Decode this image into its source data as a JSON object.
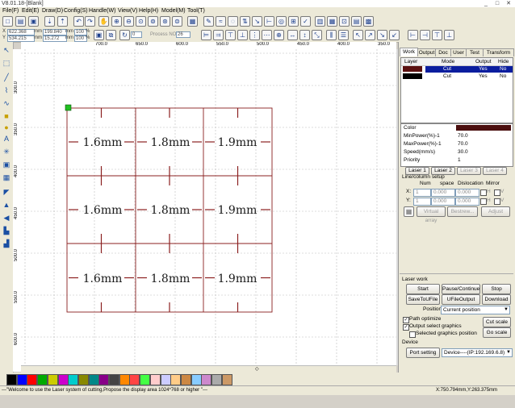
{
  "window": {
    "title": "V8.01.18-[Blank]",
    "controls": [
      "_",
      "□",
      "✕"
    ]
  },
  "menus": [
    "File(F)",
    "Edit(E)",
    "Draw(D)",
    "Config(S)",
    "Handle(W)",
    "View(V)",
    "Help(H)",
    "Model(M)",
    "Tool(T)"
  ],
  "toolbar2": {
    "x_label": "X",
    "x_value": "622.368",
    "x_unit": "mm",
    "y_label": "Y",
    "y_value": "534.215",
    "y_unit": "mm",
    "w_value": "199.840",
    "h_value": "15.272",
    "w_unit": "mm",
    "h_unit": "mm",
    "pct_w": "100",
    "pct_h": "100",
    "pct_unit": "%",
    "process_value": "0",
    "process_label": "Process NO",
    "process_no": "26"
  },
  "ruler": {
    "top": [
      "750.0",
      "700.0",
      "650.0",
      "600.0",
      "550.0",
      "500.0",
      "450.0",
      "400.0",
      "350.0"
    ],
    "left": [
      "300.0",
      "350.0",
      "400.0",
      "450.0",
      "500.0",
      "550.0",
      "600.0"
    ]
  },
  "canvas": {
    "labels": [
      "1.6mm",
      "1.8mm",
      "1.9mm",
      "1.6mm",
      "1.8mm",
      "1.9mm",
      "1.6mm",
      "1.8mm",
      "1.9mm"
    ],
    "line_color": "#8b2020",
    "handle_color": "#20c020"
  },
  "panel": {
    "tabs": [
      "Work",
      "Output",
      "Doc",
      "User",
      "Test",
      "Transform"
    ],
    "layer_headers": [
      "Layer",
      "Mode",
      "Output",
      "Hide"
    ],
    "layers": [
      {
        "color": "#5a1010",
        "mode": "Cut",
        "output": "Yes",
        "hide": "No",
        "selected": true
      },
      {
        "color": "#000000",
        "mode": "Cut",
        "output": "Yes",
        "hide": "No",
        "selected": false
      }
    ],
    "props": [
      {
        "label": "Color",
        "value": ""
      },
      {
        "label": "MinPower(%)-1",
        "value": "70.0"
      },
      {
        "label": "MaxPower(%)-1",
        "value": "70.0"
      },
      {
        "label": "Speed(mm/s)",
        "value": "30.0"
      },
      {
        "label": "Priority",
        "value": "1"
      }
    ],
    "prop_color": "#4a0e0e",
    "layer_buttons": [
      "Laser 1",
      "Laser 2",
      "Laser 3",
      "Laser 4"
    ],
    "array_title": "Line/column setup",
    "array_headers": [
      "Num",
      "space",
      "Dislocation",
      "Mirror"
    ],
    "array_rows": [
      {
        "axis": "X:",
        "num": "1",
        "space": "0.000",
        "disloc": "0.000",
        "m1": "H",
        "m2": "V"
      },
      {
        "axis": "Y:",
        "num": "1",
        "space": "0.000",
        "disloc": "0.000",
        "m1": "H",
        "m2": "V"
      }
    ],
    "array_buttons": [
      "Virtual array",
      "Bestrew...",
      "Adjust"
    ],
    "laserwork_title": "Laser work",
    "work_buttons": [
      "Start",
      "Pause/Continue",
      "Stop",
      "SaveToUFile",
      "UFileOutput",
      "Download"
    ],
    "position_label": "Position:",
    "position_value": "Current position",
    "checks": [
      {
        "label": "Path optimize",
        "checked": true
      },
      {
        "label": "Output select graphics",
        "checked": true
      },
      {
        "label": "Selected graphics position",
        "checked": false
      }
    ],
    "cut_scale": "Cut scale",
    "go_scale": "Go scale",
    "device_title": "Device",
    "port_setting": "Port setting",
    "device_value": "Device----(IP:192.169.6.8)"
  },
  "palette": [
    "#000000",
    "#0000ff",
    "#ff0000",
    "#00aa00",
    "#cccc00",
    "#cc00cc",
    "#00cccc",
    "#888800",
    "#008888",
    "#880088",
    "#444444",
    "#ff8800",
    "#ff4444",
    "#44ff44",
    "#ffcccc",
    "#ccccff",
    "#ffcc88",
    "#cc8844",
    "#88ccff",
    "#cc88cc",
    "#aaaaaa",
    "#cc9966"
  ],
  "status": {
    "message": "---\"Welcome to use the Laser system of cutting,Propose the display area 1024*768 or higher \"---",
    "position": "X:750.794mm,Y:263.375mm"
  }
}
